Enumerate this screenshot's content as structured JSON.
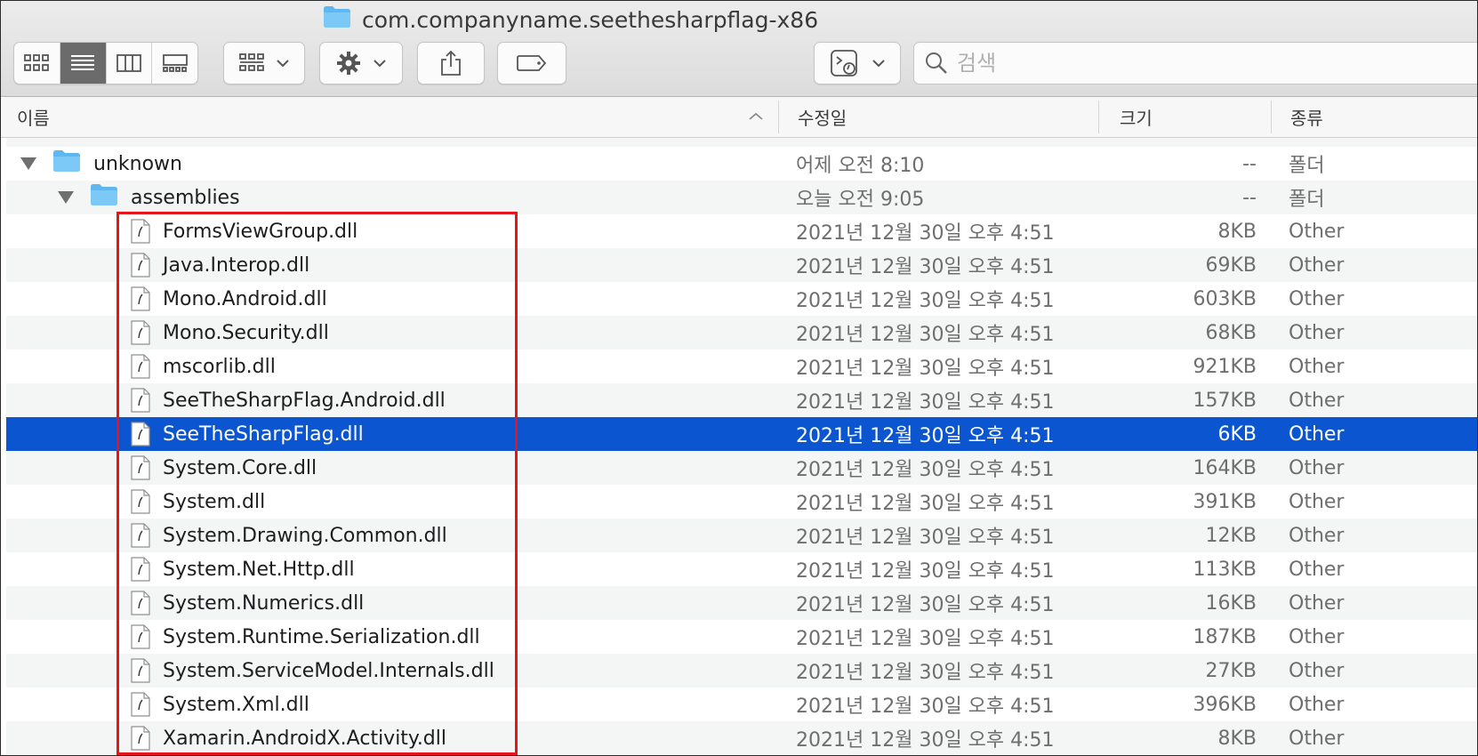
{
  "window": {
    "title": "com.companyname.seethesharpflag-x86"
  },
  "toolbar": {
    "view_modes": [
      "icon-view",
      "list-view",
      "column-view",
      "gallery-view"
    ],
    "active_view": "list-view",
    "group_icon": "group-grid-icon",
    "action_icon": "gear-icon",
    "share_icon": "share-icon",
    "tag_icon": "tag-icon",
    "script_icon": "script-icon",
    "search_placeholder": "검색"
  },
  "columns": {
    "name": "이름",
    "date": "수정일",
    "size": "크기",
    "kind": "종류"
  },
  "folders": [
    {
      "name": "unknown",
      "date": "어제 오전 8:10",
      "size": "--",
      "kind": "폴더"
    },
    {
      "name": "assemblies",
      "date": "오늘 오전 9:05",
      "size": "--",
      "kind": "폴더"
    }
  ],
  "files": [
    {
      "name": "FormsViewGroup.dll",
      "date": "2021년 12월 30일 오후 4:51",
      "size": "8KB",
      "kind": "Other"
    },
    {
      "name": "Java.Interop.dll",
      "date": "2021년 12월 30일 오후 4:51",
      "size": "69KB",
      "kind": "Other"
    },
    {
      "name": "Mono.Android.dll",
      "date": "2021년 12월 30일 오후 4:51",
      "size": "603KB",
      "kind": "Other"
    },
    {
      "name": "Mono.Security.dll",
      "date": "2021년 12월 30일 오후 4:51",
      "size": "68KB",
      "kind": "Other"
    },
    {
      "name": "mscorlib.dll",
      "date": "2021년 12월 30일 오후 4:51",
      "size": "921KB",
      "kind": "Other"
    },
    {
      "name": "SeeTheSharpFlag.Android.dll",
      "date": "2021년 12월 30일 오후 4:51",
      "size": "157KB",
      "kind": "Other"
    },
    {
      "name": "SeeTheSharpFlag.dll",
      "date": "2021년 12월 30일 오후 4:51",
      "size": "6KB",
      "kind": "Other",
      "selected": true
    },
    {
      "name": "System.Core.dll",
      "date": "2021년 12월 30일 오후 4:51",
      "size": "164KB",
      "kind": "Other"
    },
    {
      "name": "System.dll",
      "date": "2021년 12월 30일 오후 4:51",
      "size": "391KB",
      "kind": "Other"
    },
    {
      "name": "System.Drawing.Common.dll",
      "date": "2021년 12월 30일 오후 4:51",
      "size": "12KB",
      "kind": "Other"
    },
    {
      "name": "System.Net.Http.dll",
      "date": "2021년 12월 30일 오후 4:51",
      "size": "113KB",
      "kind": "Other"
    },
    {
      "name": "System.Numerics.dll",
      "date": "2021년 12월 30일 오후 4:51",
      "size": "16KB",
      "kind": "Other"
    },
    {
      "name": "System.Runtime.Serialization.dll",
      "date": "2021년 12월 30일 오후 4:51",
      "size": "187KB",
      "kind": "Other"
    },
    {
      "name": "System.ServiceModel.Internals.dll",
      "date": "2021년 12월 30일 오후 4:51",
      "size": "27KB",
      "kind": "Other"
    },
    {
      "name": "System.Xml.dll",
      "date": "2021년 12월 30일 오후 4:51",
      "size": "396KB",
      "kind": "Other"
    },
    {
      "name": "Xamarin.AndroidX.Activity.dll",
      "date": "2021년 12월 30일 오후 4:51",
      "size": "8KB",
      "kind": "Other"
    }
  ],
  "colors": {
    "selection": "#0b56d0",
    "highlight_box": "#e8141c",
    "folder": "#5fb7f0"
  }
}
